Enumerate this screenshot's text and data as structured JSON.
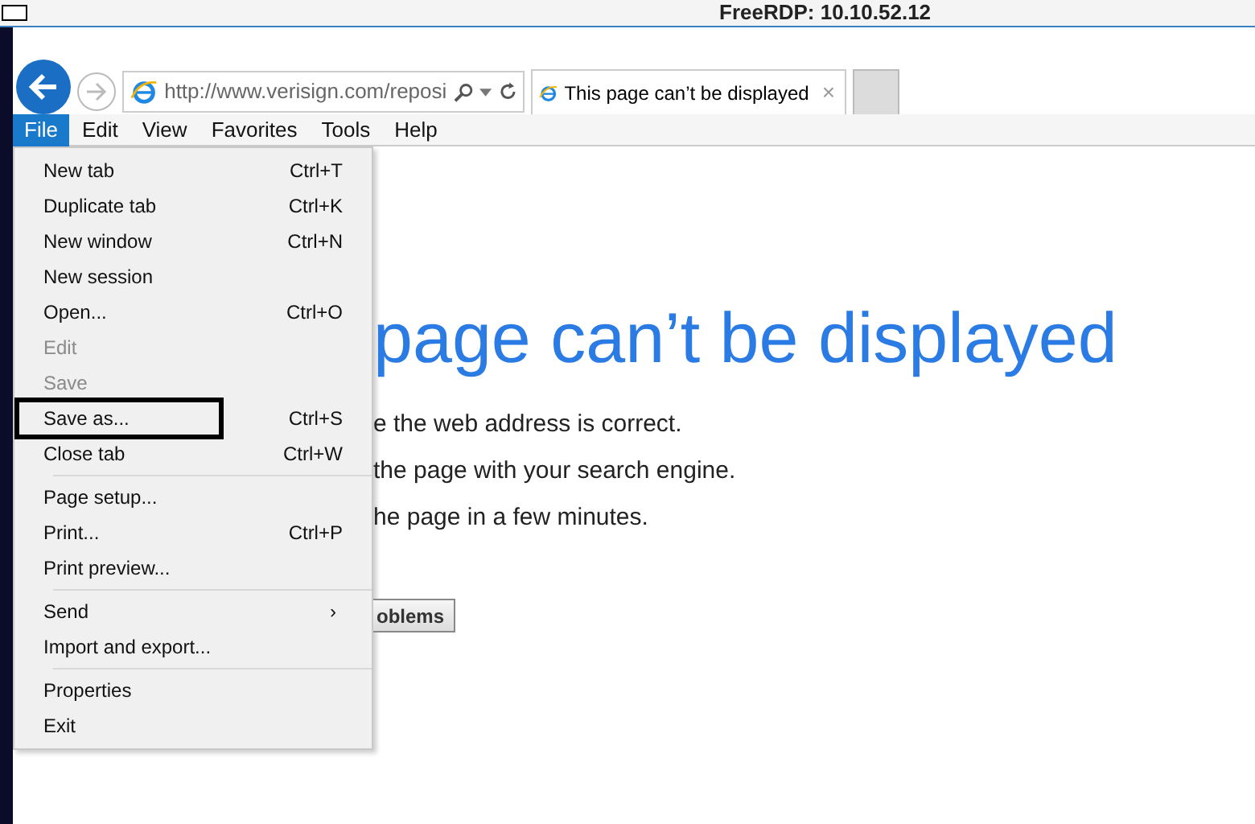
{
  "window": {
    "title": "FreeRDP: 10.10.52.12"
  },
  "address_bar": {
    "url": "http://www.verisign.com/reposi"
  },
  "tabs": [
    {
      "label": "This page can’t be displayed",
      "selected": true,
      "close": "×"
    }
  ],
  "menu_bar": [
    {
      "label": "File",
      "selected": true
    },
    {
      "label": "Edit",
      "selected": false
    },
    {
      "label": "View",
      "selected": false
    },
    {
      "label": "Favorites",
      "selected": false
    },
    {
      "label": "Tools",
      "selected": false
    },
    {
      "label": "Help",
      "selected": false
    }
  ],
  "file_menu": [
    [
      {
        "label": "New tab",
        "shortcut": "Ctrl+T",
        "disabled": false,
        "highlighted": false
      },
      {
        "label": "Duplicate tab",
        "shortcut": "Ctrl+K",
        "disabled": false,
        "highlighted": false
      },
      {
        "label": "New window",
        "shortcut": "Ctrl+N",
        "disabled": false,
        "highlighted": false
      },
      {
        "label": "New session",
        "disabled": false,
        "highlighted": false
      },
      {
        "label": "Open...",
        "shortcut": "Ctrl+O",
        "disabled": false,
        "highlighted": false
      },
      {
        "label": "Edit",
        "disabled": true,
        "highlighted": false
      },
      {
        "label": "Save",
        "disabled": true,
        "highlighted": false
      },
      {
        "label": "Save as...",
        "shortcut": "Ctrl+S",
        "disabled": false,
        "highlighted": true
      },
      {
        "label": "Close tab",
        "shortcut": "Ctrl+W",
        "disabled": false,
        "highlighted": false
      }
    ],
    [
      {
        "label": "Page setup...",
        "disabled": false,
        "highlighted": false
      },
      {
        "label": "Print...",
        "shortcut": "Ctrl+P",
        "disabled": false,
        "highlighted": false
      },
      {
        "label": "Print preview...",
        "disabled": false,
        "highlighted": false
      }
    ],
    [
      {
        "label": "Send",
        "submenu": "›",
        "disabled": false,
        "highlighted": false
      },
      {
        "label": "Import and export...",
        "disabled": false,
        "highlighted": false
      }
    ],
    [
      {
        "label": "Properties",
        "disabled": false,
        "highlighted": false
      },
      {
        "label": "Exit",
        "disabled": false,
        "highlighted": false
      }
    ]
  ],
  "page": {
    "heading": "page can’t be displayed",
    "lines": [
      "e the web address is correct.",
      "the page with your search engine.",
      "he page in a few minutes."
    ],
    "button": "oblems"
  }
}
